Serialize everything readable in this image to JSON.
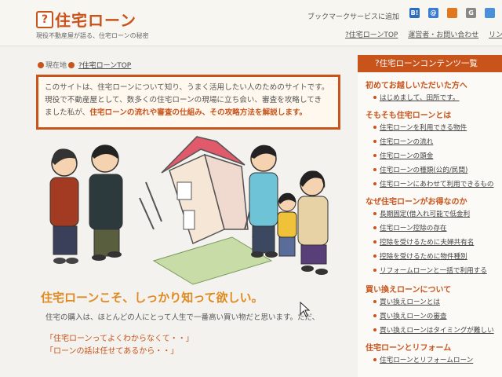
{
  "header": {
    "logo_icon": "?",
    "title": "住宅ローン",
    "subtitle": "現役不動産屋が語る、住宅ローンの秘密",
    "bookmark_text": "ブックマークサービスに追加",
    "bookmark_icons": [
      "B!",
      "@",
      "G"
    ],
    "top_links": [
      "?住宅ローンTOP",
      "運営者・お問い合わせ",
      "リンク"
    ]
  },
  "breadcrumb": {
    "label": "現在地",
    "current": "?住宅ローンTOP"
  },
  "intro": {
    "line1": "このサイトは、住宅ローンについて知り、うまく活用したい人のためのサイトです。",
    "line2": "現役で不動産屋として、数多くの住宅ローンの現場に立ち会い、審査を攻略してき",
    "line3_a": "ました私が、",
    "line3_b": "住宅ローンの流れや審査の仕組み、その攻略方法を解説します。"
  },
  "headline": "住宅ローンこそ、しっかり知って欲しい。",
  "body": "住宅の購入は、ほとんどの人にとって人生で一番高い買い物だと思います。ただ、",
  "quotes": [
    "「住宅ローンってよくわからなくて・・」",
    "「ローンの話は任せてあるから・・」"
  ],
  "sidebar": {
    "title": "?住宅ローンコンテンツ一覧",
    "sections": [
      {
        "heading": "初めてお越しいただいた方へ",
        "items": [
          "はじめまして、田所です。"
        ]
      },
      {
        "heading": "そもそも住宅ローンとは",
        "items": [
          "住宅ローンを利用できる物件",
          "住宅ローンの流れ",
          "住宅ローンの頭金",
          "住宅ローンの種類(公的/民間)",
          "住宅ローンにあわせて利用できるもの"
        ]
      },
      {
        "heading": "なぜ住宅ローンがお得なのか",
        "items": [
          "長期固定(借入れ可能で低金利",
          "住宅ローン控除の存在",
          "控除を受けるために夫婦共有名",
          "控除を受けるために物件種別",
          "リフォームローンと一括で利用する"
        ]
      },
      {
        "heading": "買い換えローンについて",
        "items": [
          "買い換えローンとは",
          "買い換えローンの審査",
          "買い換えローンはタイミングが難しい"
        ]
      },
      {
        "heading": "住宅ローンとリフォーム",
        "items": [
          "住宅ローンとリフォームローン"
        ]
      }
    ]
  },
  "colors": {
    "accent": "#c8541c",
    "headline": "#e08a22"
  }
}
